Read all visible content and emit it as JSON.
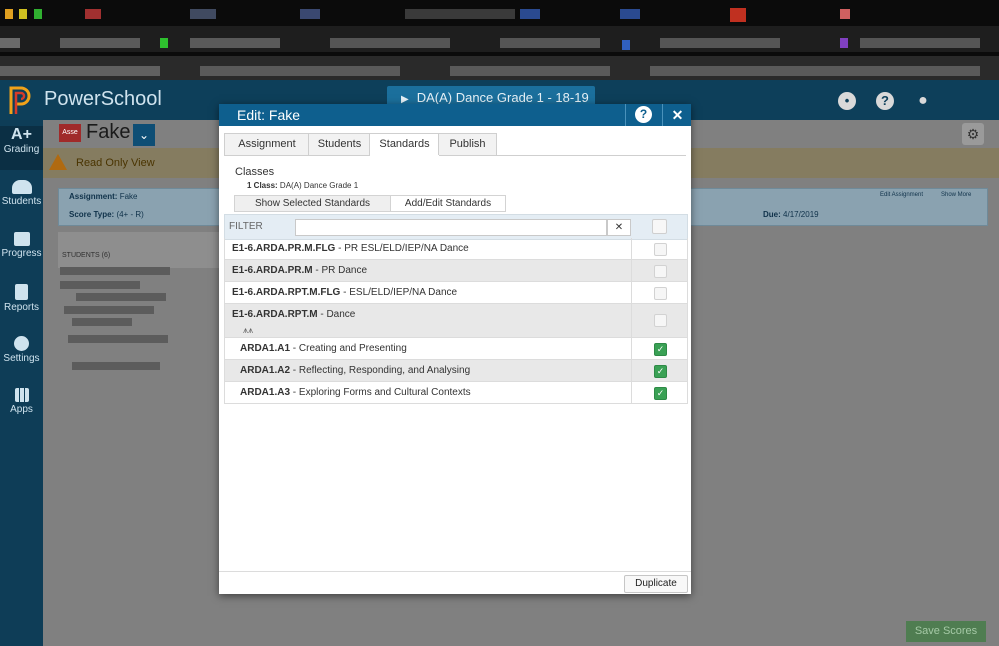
{
  "app": {
    "brand": "PowerSchool",
    "course_selector": "DA(A) Dance Grade 1  -  18-19"
  },
  "leftnav": {
    "items": [
      {
        "label": "Grading",
        "glyph": "A+"
      },
      {
        "label": "Students"
      },
      {
        "label": "Progress"
      },
      {
        "label": "Reports"
      },
      {
        "label": "Settings"
      },
      {
        "label": "Apps"
      }
    ]
  },
  "page": {
    "badge": "Asse",
    "title": "Fake",
    "readonly": "Read Only View",
    "assignment_label": "Assignment:",
    "assignment_value": "Fake",
    "score_type_label": "Score Type:",
    "score_type_value": "(4+ - R)",
    "edit_assignment": "Edit Assignment",
    "show_more": "Show More",
    "due_label": "Due:",
    "due_value": "4/17/2019",
    "students_label": "STUDENTS (6)",
    "save_scores": "Save Scores"
  },
  "modal": {
    "title": "Edit: Fake",
    "help_glyph": "?",
    "close_glyph": "✕",
    "tabs": [
      "Assignment",
      "Students",
      "Standards",
      "Publish"
    ],
    "active_tab": "Standards",
    "classes_label": "Classes",
    "class_count": "1 Class:",
    "class_name": "DA(A) Dance Grade 1",
    "subtabs": [
      "Show Selected Standards",
      "Add/Edit Standards"
    ],
    "filter_label": "FILTER",
    "filter_value": "",
    "filter_clear": "✕",
    "standards": [
      {
        "code": "E1-6.ARDA.PR.M.FLG",
        "desc": " - PR ESL/ELD/IEP/NA Dance",
        "checked": false,
        "child": false
      },
      {
        "code": "E1-6.ARDA.PR.M",
        "desc": " - PR Dance",
        "checked": false,
        "child": false
      },
      {
        "code": "E1-6.ARDA.RPT.M.FLG",
        "desc": " - ESL/ELD/IEP/NA Dance",
        "checked": false,
        "child": false
      },
      {
        "code": "E1-6.ARDA.RPT.M",
        "desc": " - Dance",
        "checked": false,
        "child": false
      },
      {
        "code": "ARDA1.A1",
        "desc": " - Creating and Presenting",
        "checked": true,
        "child": true
      },
      {
        "code": "ARDA1.A2",
        "desc": " - Reflecting, Responding, and Analysing",
        "checked": true,
        "child": true
      },
      {
        "code": "ARDA1.A3",
        "desc": " - Exploring Forms and Cultural Contexts",
        "checked": true,
        "child": true
      }
    ],
    "duplicate": "Duplicate"
  },
  "colors": {
    "header": "#0d3f5a",
    "modal_header": "#0e5f8e",
    "check_on": "#3aa155",
    "save_button": "#4f7d51"
  }
}
